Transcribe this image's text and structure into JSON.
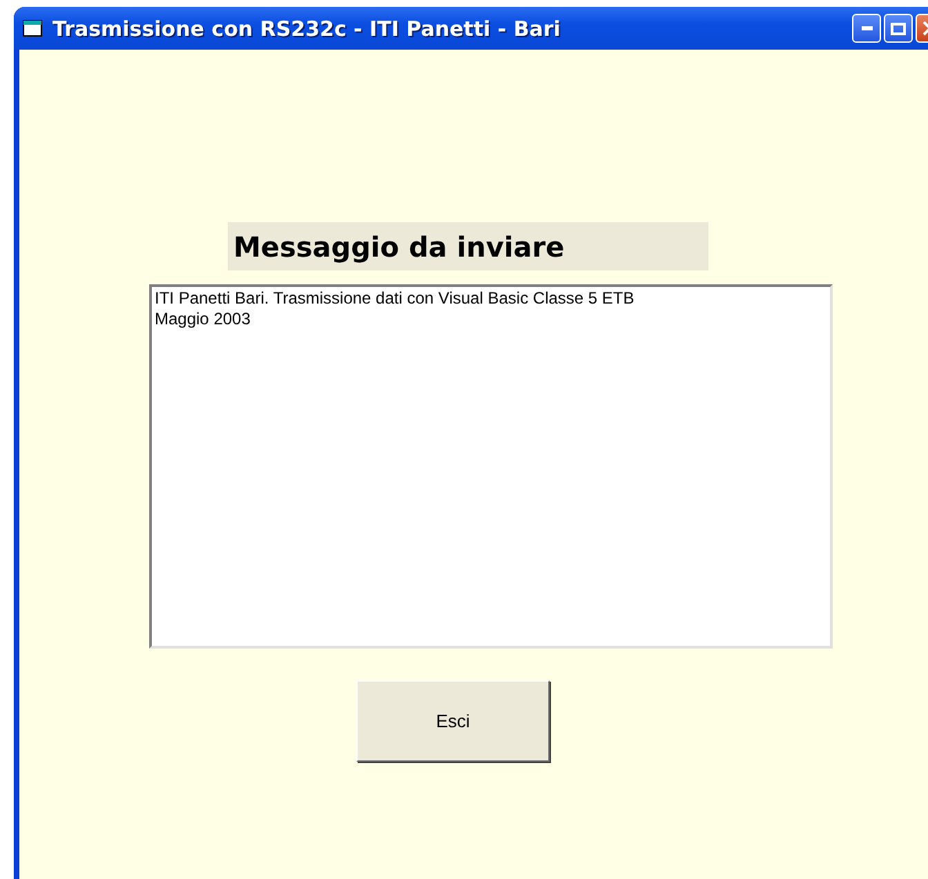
{
  "window": {
    "title": "Trasmissione con RS232c - ITI Panetti - Bari"
  },
  "heading": "Messaggio da inviare",
  "message": {
    "value": "ITI Panetti Bari. Trasmissione dati con Visual Basic Classe 5 ETB\nMaggio 2003"
  },
  "buttons": [
    "Esci"
  ]
}
